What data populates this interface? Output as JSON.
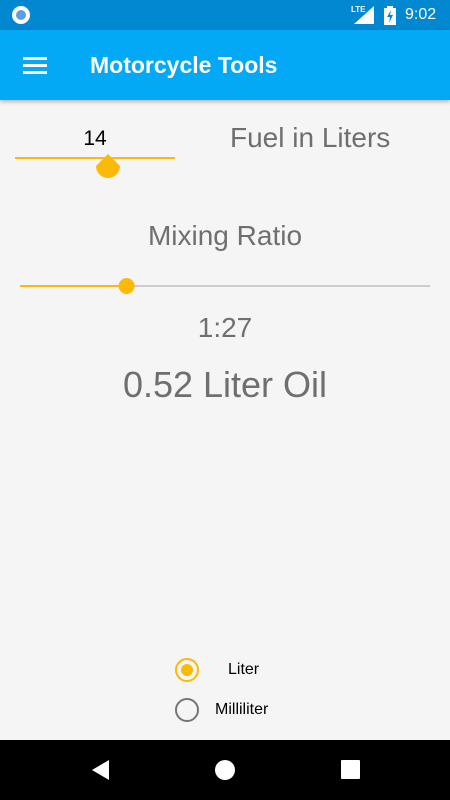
{
  "status_bar": {
    "network": "LTE",
    "time": "9:02",
    "icons": [
      "app-notification-icon",
      "signal-icon",
      "battery-charging-icon"
    ]
  },
  "app_bar": {
    "title": "Motorcycle Tools",
    "menu_icon": "hamburger-menu-icon"
  },
  "fuel": {
    "value": "14",
    "label": "Fuel in Liters"
  },
  "mixing": {
    "label": "Mixing Ratio",
    "ratio": "1:27",
    "slider_fraction": 0.26
  },
  "result": {
    "text": "0.52 Liter Oil"
  },
  "unit_options": [
    {
      "label": "Liter",
      "checked": true
    },
    {
      "label": "Milliliter",
      "checked": false
    }
  ],
  "nav": {
    "icons": [
      "back-icon",
      "home-icon",
      "recents-icon"
    ]
  },
  "colors": {
    "status_bar": "#0288d1",
    "app_bar": "#03a9f4",
    "accent": "#fbb909",
    "track_inactive": "#cccccc"
  }
}
